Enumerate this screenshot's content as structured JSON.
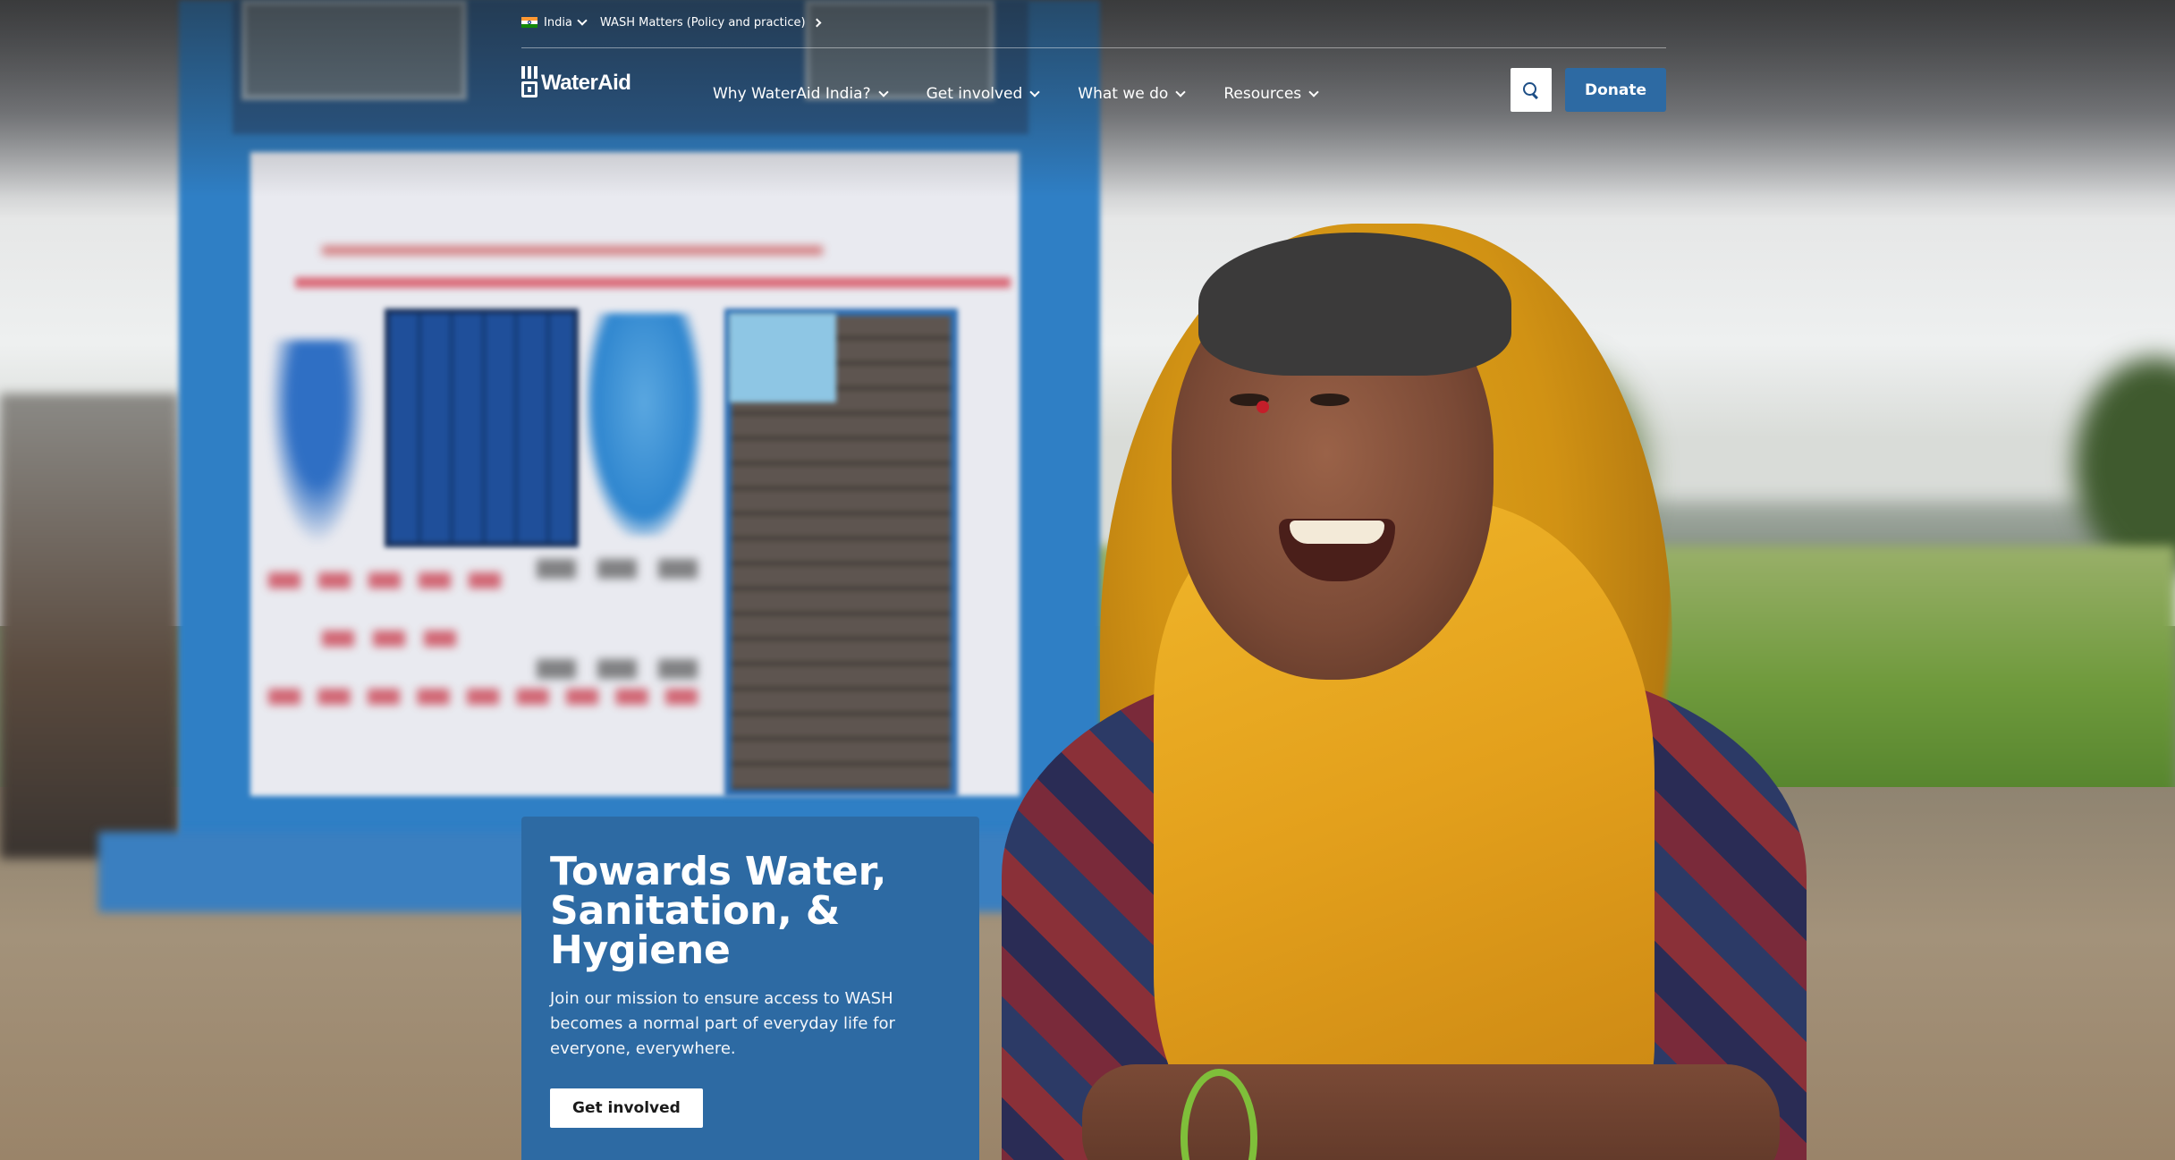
{
  "utility": {
    "country_label": "India",
    "wash_link_label": "WASH Matters (Policy and practice)"
  },
  "logo": {
    "text": "WaterAid"
  },
  "nav": {
    "items": [
      {
        "label": "Why WaterAid India?"
      },
      {
        "label": "Get involved"
      },
      {
        "label": "What we do"
      },
      {
        "label": "Resources"
      }
    ]
  },
  "header": {
    "donate_label": "Donate",
    "search_icon": "search-icon"
  },
  "hero": {
    "title": "Towards Water, Sanitation, & Hygiene",
    "subtitle": "Join our mission to ensure access to WASH becomes a normal part of everyday life for everyone, everywhere.",
    "cta_label": "Get involved"
  },
  "colors": {
    "brand_blue": "#2d6aa3",
    "white": "#ffffff"
  }
}
